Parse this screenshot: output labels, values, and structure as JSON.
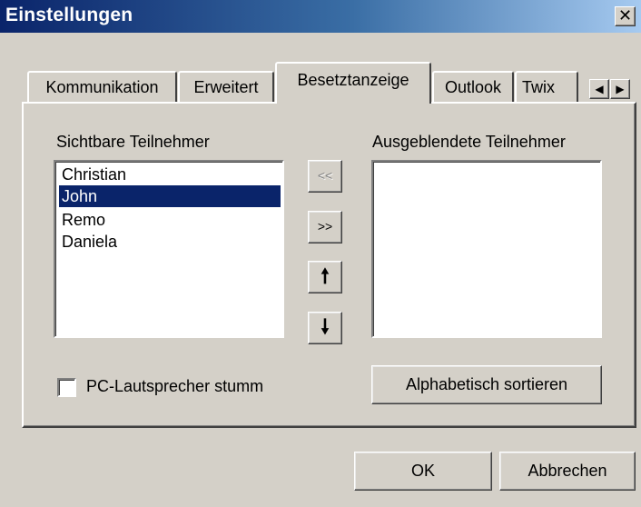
{
  "window": {
    "title": "Einstellungen",
    "close_label": "✕"
  },
  "tabs": [
    {
      "label": "Kommunikation"
    },
    {
      "label": "Erweitert"
    },
    {
      "label": "Besetztanzeige",
      "active": true
    },
    {
      "label": "Outlook"
    },
    {
      "label": "Twix"
    }
  ],
  "tab_scroll": {
    "left_icon": "◀",
    "right_icon": "▶"
  },
  "visible_participants": {
    "label": "Sichtbare Teilnehmer",
    "items": [
      "Christian",
      "John",
      "Remo",
      "Daniela"
    ],
    "selected": "John"
  },
  "hidden_participants": {
    "label": "Ausgeblendete Teilnehmer",
    "items": []
  },
  "move_buttons": {
    "add_label": "<<",
    "remove_label": ">>",
    "up_icon": "🠕",
    "down_icon": "🠗"
  },
  "mute_checkbox": {
    "label": "PC-Lautsprecher stumm",
    "checked": false
  },
  "sort_button": {
    "label": "Alphabetisch sortieren"
  },
  "footer": {
    "ok_label": "OK",
    "cancel_label": "Abbrechen"
  },
  "colors": {
    "title_gradient_start": "#0a246a",
    "title_gradient_end": "#a6caf0",
    "face": "#d4d0c8",
    "selection": "#0a246a"
  }
}
